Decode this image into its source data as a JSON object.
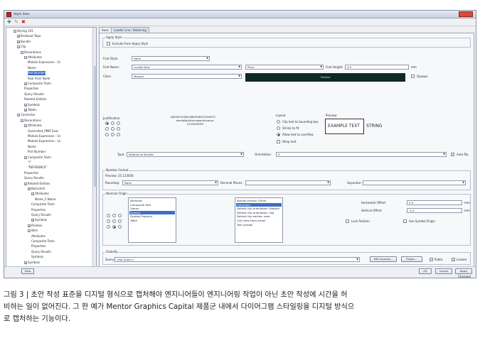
{
  "window": {
    "title": "Style Sets"
  },
  "toolbar": {
    "add_icon": "✚",
    "edit_icon": "✎",
    "delete_icon": "✖"
  },
  "tree": [
    {
      "label": "Styling 101",
      "expander": "⊟"
    },
    {
      "label": "Breakout Tape",
      "expander": "⊞"
    },
    {
      "label": "Bundle",
      "expander": "⊞"
    },
    {
      "label": "Clip",
      "expander": "⊟"
    },
    {
      "label": "Decorations",
      "expander": "⊟"
    },
    {
      "label": "Attributes",
      "expander": "⊟"
    },
    {
      "label": "Module Expression - Gr",
      "expander": ""
    },
    {
      "label": "Name",
      "expander": ""
    },
    {
      "label": "Part Number",
      "expander": ""
    },
    {
      "label": "Row From Node",
      "expander": ""
    },
    {
      "label": "Composite Texts",
      "expander": "⊞"
    },
    {
      "label": "Properties",
      "expander": ""
    },
    {
      "label": "Query Results",
      "expander": ""
    },
    {
      "label": "Related Entities",
      "expander": ""
    },
    {
      "label": "Symbols",
      "expander": "⊞"
    },
    {
      "label": "Tables",
      "expander": "⊞"
    },
    {
      "label": "Connector",
      "expander": "⊟"
    },
    {
      "label": "Decorations",
      "expander": "⊟"
    },
    {
      "label": "Attributes",
      "expander": "⊟"
    },
    {
      "label": "Generated_PMIP Exec",
      "expander": ""
    },
    {
      "label": "Module Expression - Gr",
      "expander": ""
    },
    {
      "label": "Module Expression - Lk",
      "expander": ""
    },
    {
      "label": "Name",
      "expander": ""
    },
    {
      "label": "Part Number",
      "expander": ""
    },
    {
      "label": "Composite Texts",
      "expander": "⊟"
    },
    {
      "label": "\"/\"",
      "expander": ""
    },
    {
      "label": "\"REFERENCE\"",
      "expander": ""
    },
    {
      "label": "Properties",
      "expander": ""
    },
    {
      "label": "Query Results",
      "expander": ""
    },
    {
      "label": "Related Entities",
      "expander": "⊟"
    },
    {
      "label": "Backshell",
      "expander": "⊟"
    },
    {
      "label": "Attributes",
      "expander": "⊟"
    },
    {
      "label": "Name_2.Name",
      "expander": ""
    },
    {
      "label": "Composite Texts",
      "expander": ""
    },
    {
      "label": "Properties",
      "expander": ""
    },
    {
      "label": "Query Results",
      "expander": ""
    },
    {
      "label": "Symbols",
      "expander": "⊞"
    },
    {
      "label": "Position",
      "expander": "⊞"
    },
    {
      "label": "Wire",
      "expander": "⊟"
    },
    {
      "label": "Attributes",
      "expander": ""
    },
    {
      "label": "Composite Texts",
      "expander": ""
    },
    {
      "label": "Properties",
      "expander": ""
    },
    {
      "label": "Query Results",
      "expander": ""
    },
    {
      "label": "Symbols",
      "expander": ""
    },
    {
      "label": "Symbols",
      "expander": "⊞"
    }
  ],
  "tabs": [
    "Basic",
    "Leader Line / Balloning"
  ],
  "apply_style": {
    "group_label": "Apply Style",
    "exclude_label": "Exclude from Apply Style"
  },
  "font": {
    "style_label": "Font Style:",
    "style_value": "None",
    "name_label": "Font Name:",
    "name_value": "Lucida Sans",
    "weight_value": "Plain",
    "height_label": "Font Height:",
    "height_value": "4.0",
    "height_unit": "mm",
    "color_label": "Color:",
    "color_value": "Manual",
    "preview_text": "Preview",
    "opaque_label": "Opaque"
  },
  "justification": {
    "label": "Justification:",
    "sample_upper": "ABCDEFGHIJKLMNOPQRSTUVWXYZ",
    "sample_lower": "abcdefghijklmnopqrstuvwxyz",
    "sample_digits": "0123456789"
  },
  "layout": {
    "label": "Layout",
    "options": [
      "Clip text to bounding box",
      "Shrink to fit",
      "Allow text to overflow"
    ],
    "selected": 2,
    "wrap_label": "Wrap text"
  },
  "preview": {
    "label": "Preview",
    "boxed_text": "EXAMPLE TEXT",
    "plain_text": "STRING"
  },
  "type_row": {
    "label": "Type:",
    "value": "Relative to Bundle",
    "orientation_label": "Orientation:",
    "orientation_value": "X",
    "autoflip_label": "Auto flip"
  },
  "number_format": {
    "group_label": "Number Format",
    "preview_label": "Preview:",
    "preview_value": "25.123456",
    "rounding_label": "Rounding:",
    "rounding_value": "None",
    "decimal_label": "Decimal Places:",
    "separator_label": "Separator:"
  },
  "nominal_origin": {
    "group_label": "Nominal Origin",
    "list1": [
      "Attribute",
      "Composite Text",
      "Owner",
      "Symbol",
      "Symbol Property",
      "Table"
    ],
    "list1_selected": 3,
    "list2": [
      "Bundle section 10mm",
      "Unionized",
      "Default clip orientation -Bottom",
      "Default clip orientation -Top",
      "Default clip section view",
      "Coil View-From arrow",
      "Tool symbol"
    ],
    "list2_selected": 1,
    "h_offset_label": "Horizontal Offset:",
    "h_offset_value": "0.0",
    "h_offset_unit": "mm",
    "v_offset_label": "Vertical Offset:",
    "v_offset_value": "-4.4",
    "v_offset_unit": "mm",
    "lock_label": "Lock Position",
    "use_symbol_label": "Use Symbol Origin"
  },
  "visibility": {
    "group_label": "Visibility",
    "query_label": "Query:",
    "query_value": "<No Query>",
    "edit_button": "Edit Queries...",
    "plugin_button": "Plugin...",
    "public_label": "Public",
    "locked_label": "Locked"
  },
  "buttons": {
    "help": "Help",
    "ok": "OK",
    "cancel": "Cancel",
    "apply": "Apply"
  },
  "status": {
    "changed": "Changed"
  },
  "caption": {
    "line1": "그림 3 | 초안 작성 표준을 디지털 형식으로 캡처해야 엔지니어들이 엔지니어링 작업이 아닌 초안 작성에 시간을 허",
    "line2": "비하는 일이 없어진다. 그 한 예가 Mentor Graphics Capital 제품군 내에서 다이어그램 스타일링을 디지털 방식으",
    "line3": "로 캡처하는 기능이다."
  },
  "colors": {
    "accent": "#3d6fc4",
    "preview_bg": "#0d2a22",
    "titlebar_close": "#d84a3a"
  }
}
